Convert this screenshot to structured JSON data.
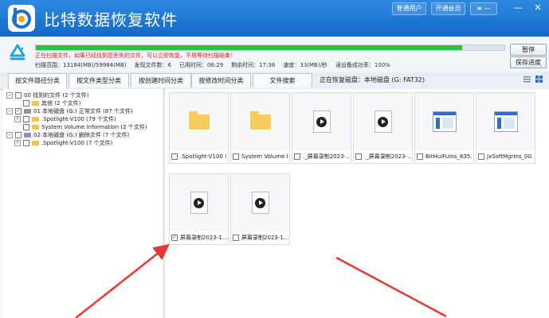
{
  "app": {
    "title": "比特数据恢复软件"
  },
  "titlebar": {
    "btn_normal_user": "普通用户",
    "btn_open_member": "开通会员",
    "menu_icon": "≡",
    "minimize": "—",
    "close": "✕"
  },
  "status": {
    "progress_percent": 91,
    "warning": "正在扫描文件，如果已经找到您丢失的文件，可以立即恢复，不用等待扫描结束！",
    "scan_range": "扫描范围：13184(MB)/59984(MB)",
    "files_found": "发现文件数：6",
    "elapsed": "已用时间：06:29",
    "remaining": "剩余时间：17:36",
    "speed": "速度：33(MB)/秒",
    "bad_sector": "读设备成功率：100%",
    "pause_button": "暂停",
    "save_progress_button": "保存进度"
  },
  "tabs": [
    "按文件路径分类",
    "按文件类型分类",
    "按创建时间分类",
    "按修改时间分类",
    "文件搜索"
  ],
  "restore_info": "正在恢复磁盘：本地磁盘 (G: FAT32)",
  "tree": [
    {
      "indent": 0,
      "expander": "−",
      "check": "",
      "icon": "none",
      "label": "00 找到的文件  (2 个文件)"
    },
    {
      "indent": 1,
      "expander": "",
      "check": "",
      "icon": "folder",
      "label": "其他  (2 个文件)"
    },
    {
      "indent": 0,
      "expander": "−",
      "check": "✓",
      "icon": "drive",
      "label": "01 本地磁盘 (G:) 正常文件 (87 个文件)"
    },
    {
      "indent": 1,
      "expander": "+",
      "check": "",
      "icon": "folder",
      "label": ".Spotlight-V100  (79 个文件)"
    },
    {
      "indent": 1,
      "expander": "",
      "check": "",
      "icon": "folder",
      "label": "System Volume Information  (2 个文件)"
    },
    {
      "indent": 0,
      "expander": "−",
      "check": "",
      "icon": "drive",
      "label": "02 本地磁盘 (G:) 删除文件 (7 个文件)"
    },
    {
      "indent": 1,
      "expander": "+",
      "check": "",
      "icon": "folder",
      "label": ".Spotlight-V100  (7 个文件)"
    }
  ],
  "files": [
    {
      "type": "folder",
      "name": ".Spotlight-V100 (...",
      "checked": false
    },
    {
      "type": "folder",
      "name": "System Volume In...",
      "checked": false
    },
    {
      "type": "video",
      "name": "._屏幕录制2023-...",
      "checked": false
    },
    {
      "type": "video",
      "name": "._屏幕录制2023-...",
      "checked": false
    },
    {
      "type": "app",
      "name": "BitHuiFuIns_835...",
      "checked": false
    },
    {
      "type": "app",
      "name": "JxSoftMgrIns_00...",
      "checked": false
    },
    {
      "type": "video",
      "name": "屏幕录制2023-1...",
      "checked": true
    },
    {
      "type": "video",
      "name": "屏幕录制2023-1...",
      "checked": false
    }
  ],
  "colors": {
    "titlebar": "#1e78d6",
    "progress": "#2fbf3b",
    "warning": "#e02020",
    "arrow": "#e53935"
  }
}
